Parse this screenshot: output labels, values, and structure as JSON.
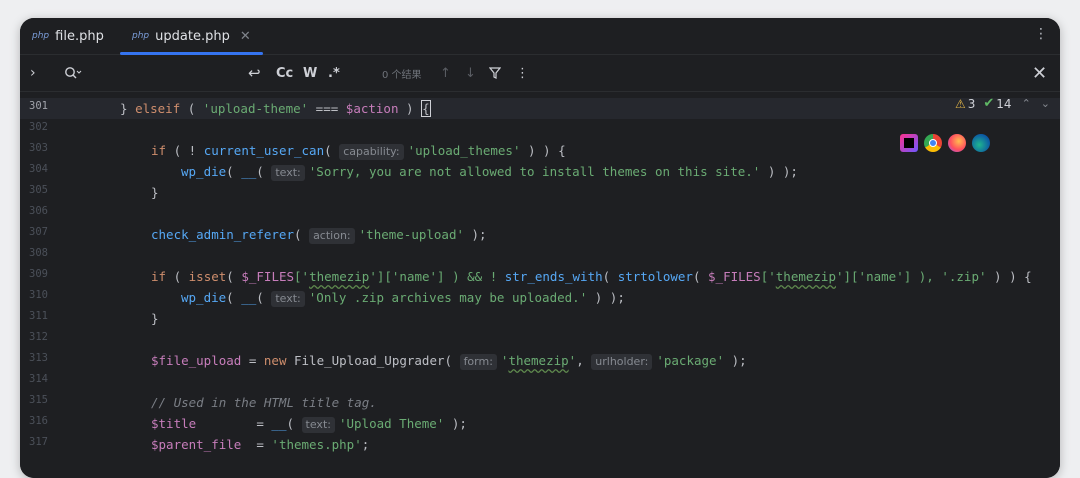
{
  "tabs": [
    {
      "icon": "php",
      "label": "file.php",
      "active": false
    },
    {
      "icon": "php",
      "label": "update.php",
      "active": true
    }
  ],
  "tab_close": "✕",
  "find": {
    "results": "0 个结果",
    "match_case": "Cc",
    "words": "W",
    "regex": ".*"
  },
  "inspections": {
    "warnings": "3",
    "ok": "14"
  },
  "line_numbers": [
    "301",
    "302",
    "303",
    "304",
    "305",
    "306",
    "307",
    "308",
    "309",
    "310",
    "311",
    "312",
    "313",
    "314",
    "315",
    "316",
    "317"
  ],
  "code": {
    "l301": {
      "a": "} ",
      "b": "elseif",
      "c": " ( ",
      "d": "'upload-theme'",
      "e": " === ",
      "f": "$action",
      "g": " ) ",
      "h": "{"
    },
    "l303": {
      "a": "if",
      "b": " ( ! ",
      "c": "current_user_can",
      "d": "( ",
      "hint": "capability:",
      "e": "'upload_themes'",
      "f": " ) ) {"
    },
    "l304": {
      "a": "wp_die",
      "b": "( ",
      "c": "__",
      "d": "( ",
      "hint": "text:",
      "e": "'Sorry, you are not allowed to install themes on this site.'",
      "f": " ) );"
    },
    "l305": {
      "a": "}"
    },
    "l307": {
      "a": "check_admin_referer",
      "b": "( ",
      "hint": "action:",
      "c": "'theme-upload'",
      "d": " );"
    },
    "l309": {
      "a": "if",
      "b": " ( ",
      "c": "isset",
      "d": "( ",
      "e": "$_FILES",
      "f": "['",
      "g": "themezip",
      "h": "']['name'] ) && ! ",
      "i": "str_ends_with",
      "j": "( ",
      "k": "strtolower",
      "l": "( ",
      "m": "$_FILES",
      "n": "['",
      "o": "themezip",
      "p": "']['name'] ), ",
      "q": "'.zip'",
      "r": " ) ) {"
    },
    "l310": {
      "a": "wp_die",
      "b": "( ",
      "c": "__",
      "d": "( ",
      "hint": "text:",
      "e": "'Only .zip archives may be uploaded.'",
      "f": " ) );"
    },
    "l311": {
      "a": "}"
    },
    "l313": {
      "a": "$file_upload",
      "b": " = ",
      "c": "new",
      "d": " File_Upload_Upgrader( ",
      "hint1": "form:",
      "e": "'",
      "f": "themezip",
      "g": "'",
      "h": ", ",
      "hint2": "urlholder:",
      "i": "'package'",
      "j": " );"
    },
    "l315": {
      "a": "// Used in the HTML title tag."
    },
    "l316": {
      "a": "$title",
      "b": "        = ",
      "c": "__",
      "d": "( ",
      "hint": "text:",
      "e": "'Upload Theme'",
      "f": " );"
    },
    "l317": {
      "a": "$parent_file",
      "b": "  = ",
      "c": "'themes.php'",
      "d": ";"
    }
  },
  "colors": {
    "accent": "#3574f0",
    "keyword": "#cf8e6d",
    "string": "#6aab73",
    "function": "#56a8f5",
    "variable": "#c77dbb"
  },
  "browser_icons": [
    "phpstorm-icon",
    "chrome-icon",
    "firefox-icon",
    "edge-icon"
  ]
}
